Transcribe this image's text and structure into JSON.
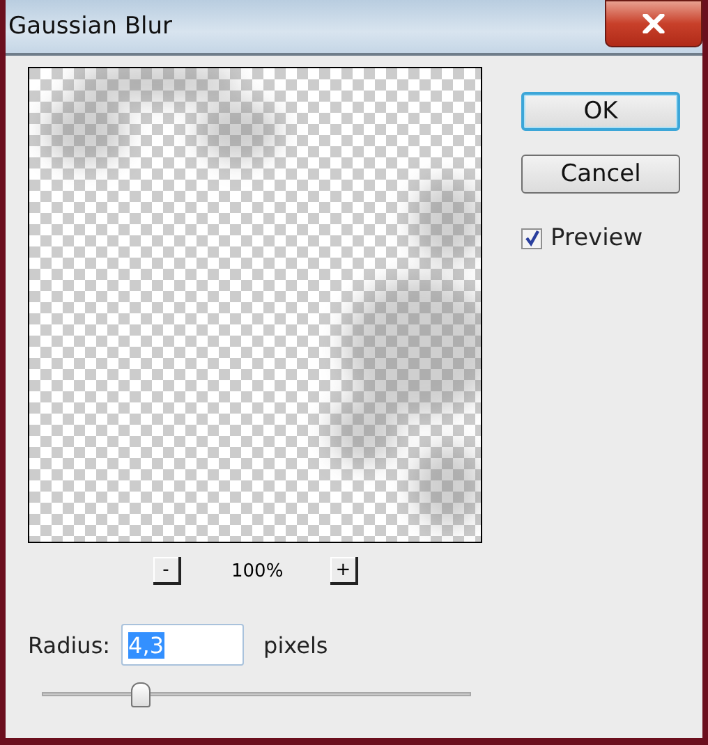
{
  "window": {
    "title": "Gaussian Blur"
  },
  "zoom": {
    "out_label": "-",
    "level_text": "100%",
    "in_label": "+"
  },
  "buttons": [
    {
      "label": "OK",
      "default": true
    },
    {
      "label": "Cancel",
      "default": false
    }
  ],
  "preview_option": {
    "label": "Preview",
    "checked": true
  },
  "radius": {
    "label": "Radius:",
    "value": "4,3",
    "unit": "pixels",
    "level": 0.23
  }
}
